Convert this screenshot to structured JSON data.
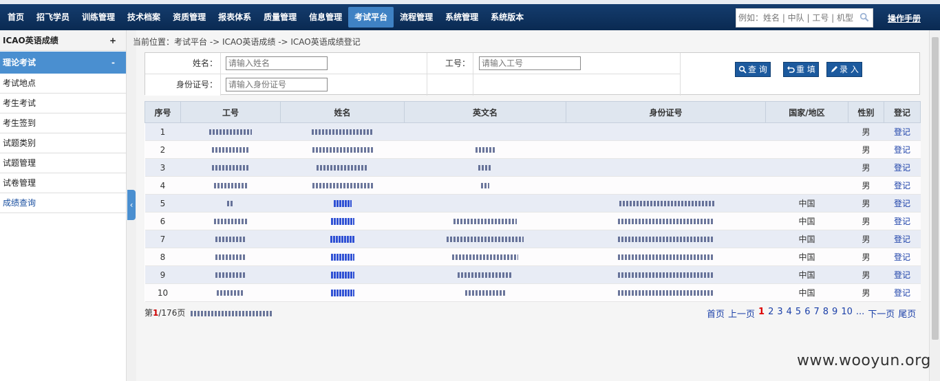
{
  "nav": {
    "items": [
      "首页",
      "招飞学员",
      "训练管理",
      "技术档案",
      "资质管理",
      "报表体系",
      "质量管理",
      "信息管理",
      "考试平台",
      "流程管理",
      "系统管理",
      "系统版本"
    ],
    "active_index": 8,
    "search_placeholder": "例如：姓名 | 中队 | 工号 | 机型",
    "manual": "操作手册"
  },
  "sidebar": {
    "header": "ICAO英语成绩",
    "header_toggle": "+",
    "section": "理论考试",
    "section_toggle": "-",
    "items": [
      "考试地点",
      "考生考试",
      "考生签到",
      "试题类别",
      "试题管理",
      "试卷管理",
      "成绩查询"
    ],
    "collapse": "‹"
  },
  "breadcrumb": "当前位置：考试平台 -> ICAO英语成绩 -> ICAO英语成绩登记",
  "filter": {
    "name_label": "姓名：",
    "name_placeholder": "请输入姓名",
    "id_label": "工号：",
    "id_placeholder": "请输入工号",
    "idcard_label": "身份证号：",
    "idcard_placeholder": "请输入身份证号",
    "query_btn": "查 询",
    "reset_btn": "重 填",
    "enter_btn": "录 入"
  },
  "table": {
    "headers": [
      "序号",
      "工号",
      "姓名",
      "英文名",
      "身份证号",
      "国家/地区",
      "性别",
      "登记"
    ],
    "rows": [
      {
        "no": "1",
        "country": "",
        "gender": "男",
        "action": "登记"
      },
      {
        "no": "2",
        "country": "",
        "gender": "男",
        "action": "登记"
      },
      {
        "no": "3",
        "country": "",
        "gender": "男",
        "action": "登记"
      },
      {
        "no": "4",
        "country": "",
        "gender": "男",
        "action": "登记"
      },
      {
        "no": "5",
        "country": "中国",
        "gender": "男",
        "action": "登记"
      },
      {
        "no": "6",
        "country": "中国",
        "gender": "男",
        "action": "登记"
      },
      {
        "no": "7",
        "country": "中国",
        "gender": "男",
        "action": "登记"
      },
      {
        "no": "8",
        "country": "中国",
        "gender": "男",
        "action": "登记"
      },
      {
        "no": "9",
        "country": "中国",
        "gender": "男",
        "action": "登记"
      },
      {
        "no": "10",
        "country": "中国",
        "gender": "男",
        "action": "登记"
      }
    ]
  },
  "pager": {
    "prefix": "第",
    "current": "1",
    "suffix": "/176页",
    "first": "首页",
    "prev": "上一页",
    "pages": [
      "1",
      "2",
      "3",
      "4",
      "5",
      "6",
      "7",
      "8",
      "9",
      "10"
    ],
    "ellipsis": "...",
    "next": "下一页",
    "last": "尾页"
  },
  "watermark": "www.wooyun.org"
}
